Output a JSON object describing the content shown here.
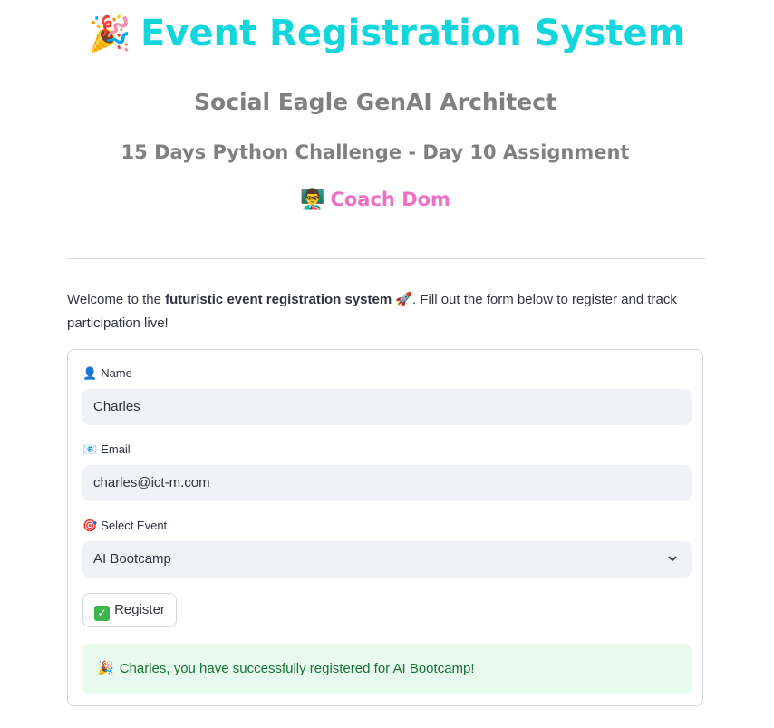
{
  "header": {
    "title_emoji": "🎉",
    "title": "Event Registration System",
    "subtitle": "Social Eagle GenAI Architect",
    "challenge": "15 Days Python Challenge - Day 10 Assignment",
    "coach_emoji": "👨‍🏫",
    "coach": "Coach Dom"
  },
  "welcome": {
    "prefix": "Welcome to the ",
    "bold": "futuristic event registration system",
    "emoji": "🚀",
    "suffix": ". Fill out the form below to register and track participation live!"
  },
  "form": {
    "name_icon": "👤",
    "name_label": "Name",
    "name_value": "Charles",
    "email_icon": "📧",
    "email_label": "Email",
    "email_value": "charles@ict-m.com",
    "event_icon": "🎯",
    "event_label": "Select Event",
    "event_value": "AI Bootcamp",
    "register_label": "Register",
    "success_emoji": "🎉",
    "success_message": "Charles, you have successfully registered for AI Bootcamp!"
  },
  "colors": {
    "title": "#12d6dc",
    "subtitle": "#808080",
    "coach": "#f06fc5",
    "success_bg": "#e8f9ee",
    "success_text": "#177233"
  }
}
